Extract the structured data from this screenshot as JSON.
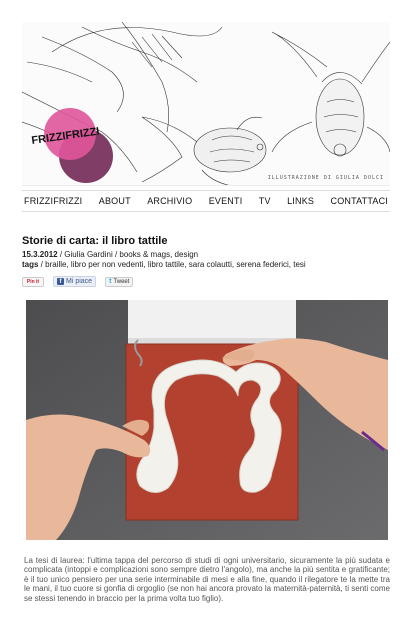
{
  "header": {
    "logo_text": "FRIZZIFRIZZI",
    "illustration_credit": "ILLUSTRAZIONE DI GIULIA DOLCI"
  },
  "nav": {
    "items": [
      {
        "label": "FRIZZIFRIZZI"
      },
      {
        "label": "ABOUT"
      },
      {
        "label": "ARCHIVIO"
      },
      {
        "label": "EVENTI"
      },
      {
        "label": "TV"
      },
      {
        "label": "LINKS"
      },
      {
        "label": "CONTATTACI"
      }
    ]
  },
  "post": {
    "title": "Storie di carta: il libro tattile",
    "date": "15.3.2012",
    "sep1": " / ",
    "author": "Giulia Gardini",
    "sep2": " / ",
    "categories": "books & mags, design",
    "tags_label": "tags",
    "tags": " / braille, libro per non vedenti, libro tattile, sara colautti, serena federici, tesi",
    "excerpt": "La tesi di laurea: l'ultima tappa del percorso di studi di ogni universitario, sicuramente la più sudata e complicata (intoppi e complicazioni sono sempre dietro l'angolo), ma anche la più sentita e gratificante; è il tuo unico pensiero per una serie interminabile di mesi e alla fine, quando il rilegatore te la mette tra le mani, il tuo cuore si gonfia di orgoglio (se non hai ancora provato la maternità-paternità, ti senti come se stessi tenendo in braccio per la prima volta tuo figlio)."
  },
  "social": {
    "pin_label": "Pin it",
    "like_label": "Mi piace",
    "tweet_label": "Tweet",
    "icons": [
      "pinterest-icon",
      "facebook-icon",
      "twitter-icon"
    ]
  },
  "colors": {
    "logo_pink": "#e0559a",
    "logo_dark": "#6a1c4c",
    "book_red": "#b2412f",
    "photo_bg": "#5a5a5c"
  }
}
